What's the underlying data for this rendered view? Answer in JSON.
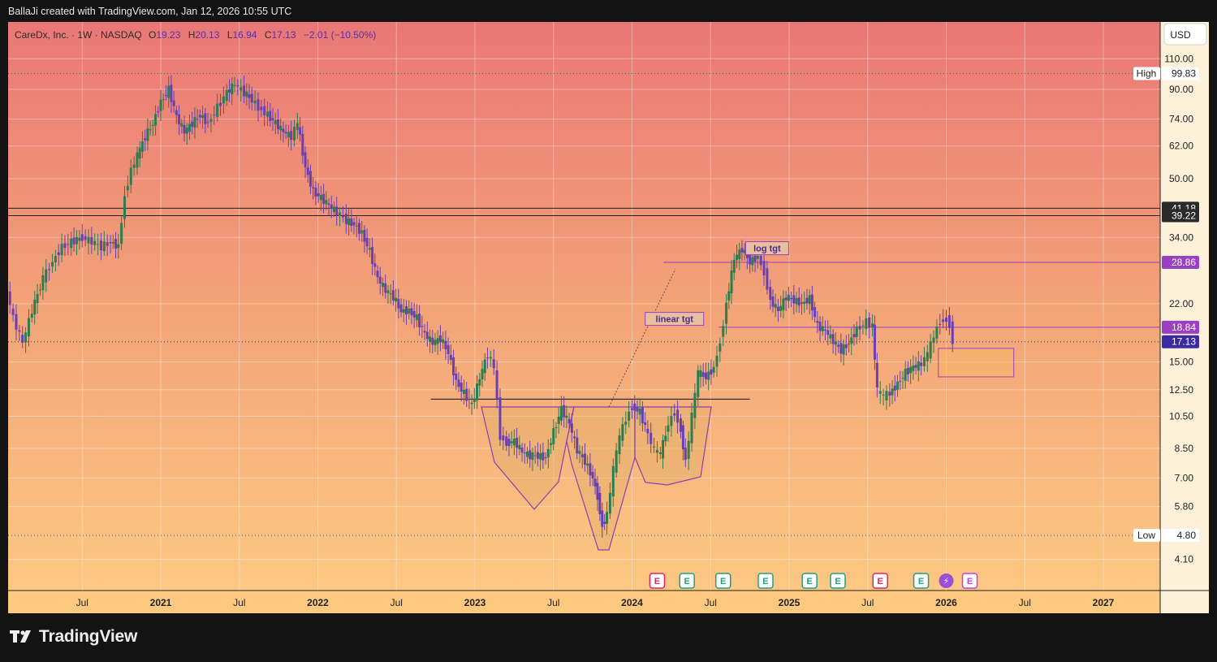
{
  "header": {
    "attribution": "BallaJi created with TradingView.com, Jan 12, 2026 10:55 UTC"
  },
  "footer": {
    "brand": "TradingView"
  },
  "chart_data": {
    "type": "candlestick",
    "title": "CareDx, Inc. · 1W · NASDAQ",
    "ohlc_label": {
      "o_key": "O",
      "o": "19.23",
      "h_key": "H",
      "h": "20.13",
      "l_key": "L",
      "l": "16.94",
      "c_key": "C",
      "c": "17.13",
      "chg": "−2.01 (−10.50%)"
    },
    "currency": "USD",
    "y_scale": "log",
    "ylim": [
      3.6,
      130
    ],
    "x_ticks": [
      {
        "label": "Jul",
        "t": 2020.5,
        "bold": false
      },
      {
        "label": "2021",
        "t": 2021.0,
        "bold": true
      },
      {
        "label": "Jul",
        "t": 2021.5,
        "bold": false
      },
      {
        "label": "2022",
        "t": 2022.0,
        "bold": true
      },
      {
        "label": "Jul",
        "t": 2022.5,
        "bold": false
      },
      {
        "label": "2023",
        "t": 2023.0,
        "bold": true
      },
      {
        "label": "Jul",
        "t": 2023.5,
        "bold": false
      },
      {
        "label": "2024",
        "t": 2024.0,
        "bold": true
      },
      {
        "label": "Jul",
        "t": 2024.5,
        "bold": false
      },
      {
        "label": "2025",
        "t": 2025.0,
        "bold": true
      },
      {
        "label": "Jul",
        "t": 2025.5,
        "bold": false
      },
      {
        "label": "2026",
        "t": 2026.0,
        "bold": true
      },
      {
        "label": "Jul",
        "t": 2026.5,
        "bold": false
      },
      {
        "label": "2027",
        "t": 2027.0,
        "bold": true
      }
    ],
    "y_ticks": [
      "110.00",
      "90.00",
      "74.00",
      "62.00",
      "50.00",
      "34.00",
      "22.00",
      "15.00",
      "12.50",
      "10.50",
      "8.50",
      "7.00",
      "5.80",
      "4.10"
    ],
    "price_tags": [
      {
        "value": "99.83",
        "prefix": "High",
        "style": "light",
        "price": 99.83
      },
      {
        "value": "41.18",
        "prefix": "",
        "style": "dark",
        "price": 41.18
      },
      {
        "value": "39.22",
        "prefix": "",
        "style": "dark",
        "price": 39.22
      },
      {
        "value": "28.86",
        "prefix": "",
        "style": "purple",
        "price": 28.86
      },
      {
        "value": "18.84",
        "prefix": "",
        "style": "purple",
        "price": 18.84
      },
      {
        "value": "17.13",
        "prefix": "",
        "style": "blue",
        "price": 17.13
      },
      {
        "value": "4.80",
        "prefix": "Low",
        "style": "light",
        "price": 4.8
      }
    ],
    "annotations": [
      {
        "text": "log tgt",
        "t": 2024.86,
        "price": 31.5
      },
      {
        "text": "linear tgt",
        "t": 2024.27,
        "price": 19.8
      }
    ],
    "horizontal_lines": [
      {
        "price": 41.18,
        "color": "#222222",
        "from": 2020.0,
        "to": 2027.6
      },
      {
        "price": 39.22,
        "color": "#222222",
        "from": 2020.0,
        "to": 2027.6
      },
      {
        "price": 28.86,
        "color": "#9b3fc4",
        "from": 2024.2,
        "to": 2027.6
      },
      {
        "price": 18.84,
        "color": "#9b3fc4",
        "from": 2024.55,
        "to": 2027.6
      },
      {
        "price": 11.75,
        "color": "#111111",
        "from": 2022.72,
        "to": 2024.75
      }
    ],
    "events": [
      {
        "t": 2024.16,
        "kind": "E",
        "color": "#e0245e"
      },
      {
        "t": 2024.35,
        "kind": "E",
        "color": "#20a080"
      },
      {
        "t": 2024.58,
        "kind": "E",
        "color": "#20a080"
      },
      {
        "t": 2024.85,
        "kind": "E",
        "color": "#20a080"
      },
      {
        "t": 2025.13,
        "kind": "E",
        "color": "#20a080"
      },
      {
        "t": 2025.31,
        "kind": "E",
        "color": "#20a080"
      },
      {
        "t": 2025.58,
        "kind": "E",
        "color": "#e0245e"
      },
      {
        "t": 2025.84,
        "kind": "E",
        "color": "#20a080"
      },
      {
        "t": 2026.0,
        "kind": "⚡",
        "color": "#9b4fd6"
      },
      {
        "t": 2026.15,
        "kind": "E",
        "color": "#c040e0"
      }
    ],
    "target_box": {
      "t0": 2025.95,
      "t1": 2026.43,
      "p_low": 13.6,
      "p_high": 16.4
    },
    "series": [
      {
        "name": "Weekly closes",
        "points": [
          [
            2019.92,
            23
          ],
          [
            2020.0,
            26
          ],
          [
            2020.06,
            20
          ],
          [
            2020.12,
            17
          ],
          [
            2020.18,
            21
          ],
          [
            2020.25,
            26
          ],
          [
            2020.31,
            29
          ],
          [
            2020.37,
            32
          ],
          [
            2020.43,
            33
          ],
          [
            2020.5,
            34
          ],
          [
            2020.56,
            33
          ],
          [
            2020.62,
            32
          ],
          [
            2020.68,
            33
          ],
          [
            2020.73,
            32
          ],
          [
            2020.77,
            45
          ],
          [
            2020.81,
            53
          ],
          [
            2020.85,
            58
          ],
          [
            2020.9,
            66
          ],
          [
            2020.95,
            72
          ],
          [
            2021.0,
            83
          ],
          [
            2021.05,
            90
          ],
          [
            2021.1,
            75
          ],
          [
            2021.15,
            68
          ],
          [
            2021.2,
            72
          ],
          [
            2021.25,
            76
          ],
          [
            2021.3,
            72
          ],
          [
            2021.36,
            80
          ],
          [
            2021.42,
            88
          ],
          [
            2021.47,
            93
          ],
          [
            2021.53,
            88
          ],
          [
            2021.58,
            84
          ],
          [
            2021.62,
            80
          ],
          [
            2021.68,
            76
          ],
          [
            2021.73,
            72
          ],
          [
            2021.78,
            68
          ],
          [
            2021.83,
            66
          ],
          [
            2021.87,
            72
          ],
          [
            2021.92,
            54
          ],
          [
            2021.97,
            46
          ],
          [
            2022.02,
            44
          ],
          [
            2022.07,
            42
          ],
          [
            2022.12,
            40
          ],
          [
            2022.18,
            38
          ],
          [
            2022.23,
            37
          ],
          [
            2022.28,
            35
          ],
          [
            2022.33,
            31
          ],
          [
            2022.38,
            26
          ],
          [
            2022.43,
            24
          ],
          [
            2022.48,
            23
          ],
          [
            2022.53,
            21
          ],
          [
            2022.58,
            21
          ],
          [
            2022.63,
            20
          ],
          [
            2022.68,
            18
          ],
          [
            2022.73,
            17
          ],
          [
            2022.78,
            17.5
          ],
          [
            2022.83,
            16
          ],
          [
            2022.88,
            13.2
          ],
          [
            2022.93,
            12.2
          ],
          [
            2022.98,
            11.3
          ],
          [
            2023.03,
            13.5
          ],
          [
            2023.08,
            15.8
          ],
          [
            2023.12,
            14.5
          ],
          [
            2023.16,
            9.2
          ],
          [
            2023.2,
            8.8
          ],
          [
            2023.25,
            8.9
          ],
          [
            2023.3,
            8.3
          ],
          [
            2023.35,
            8.1
          ],
          [
            2023.4,
            8.1
          ],
          [
            2023.45,
            8.0
          ],
          [
            2023.5,
            9.5
          ],
          [
            2023.55,
            11.0
          ],
          [
            2023.6,
            10.0
          ],
          [
            2023.65,
            8.4
          ],
          [
            2023.7,
            7.8
          ],
          [
            2023.75,
            7.0
          ],
          [
            2023.78,
            6.2
          ],
          [
            2023.81,
            5.1
          ],
          [
            2023.84,
            5.5
          ],
          [
            2023.88,
            7.4
          ],
          [
            2023.92,
            9.2
          ],
          [
            2023.96,
            10.3
          ],
          [
            2024.0,
            11.2
          ],
          [
            2024.05,
            10.8
          ],
          [
            2024.1,
            9.3
          ],
          [
            2024.14,
            8.4
          ],
          [
            2024.18,
            8.2
          ],
          [
            2024.23,
            10.0
          ],
          [
            2024.27,
            10.8
          ],
          [
            2024.31,
            9.6
          ],
          [
            2024.34,
            7.8
          ],
          [
            2024.38,
            10.5
          ],
          [
            2024.42,
            14.0
          ],
          [
            2024.47,
            13.6
          ],
          [
            2024.52,
            14.4
          ],
          [
            2024.56,
            17.2
          ],
          [
            2024.6,
            22.0
          ],
          [
            2024.65,
            29.5
          ],
          [
            2024.7,
            31.5
          ],
          [
            2024.75,
            29.0
          ],
          [
            2024.8,
            30.0
          ],
          [
            2024.84,
            27.0
          ],
          [
            2024.88,
            22.5
          ],
          [
            2024.93,
            21.0
          ],
          [
            2024.98,
            23.0
          ],
          [
            2025.03,
            22.5
          ],
          [
            2025.08,
            22.0
          ],
          [
            2025.13,
            22.8
          ],
          [
            2025.18,
            19.0
          ],
          [
            2025.23,
            18.4
          ],
          [
            2025.28,
            17.2
          ],
          [
            2025.33,
            16.2
          ],
          [
            2025.38,
            17.0
          ],
          [
            2025.43,
            18.6
          ],
          [
            2025.49,
            19.5
          ],
          [
            2025.53,
            19.0
          ],
          [
            2025.56,
            12.4
          ],
          [
            2025.6,
            12.0
          ],
          [
            2025.64,
            12.2
          ],
          [
            2025.69,
            13.0
          ],
          [
            2025.74,
            14.0
          ],
          [
            2025.79,
            14.5
          ],
          [
            2025.84,
            14.8
          ],
          [
            2025.88,
            15.8
          ],
          [
            2025.92,
            17.8
          ],
          [
            2025.96,
            19.6
          ],
          [
            2026.0,
            19.8
          ],
          [
            2026.02,
            19.2
          ],
          [
            2026.04,
            17.13
          ]
        ]
      }
    ]
  }
}
